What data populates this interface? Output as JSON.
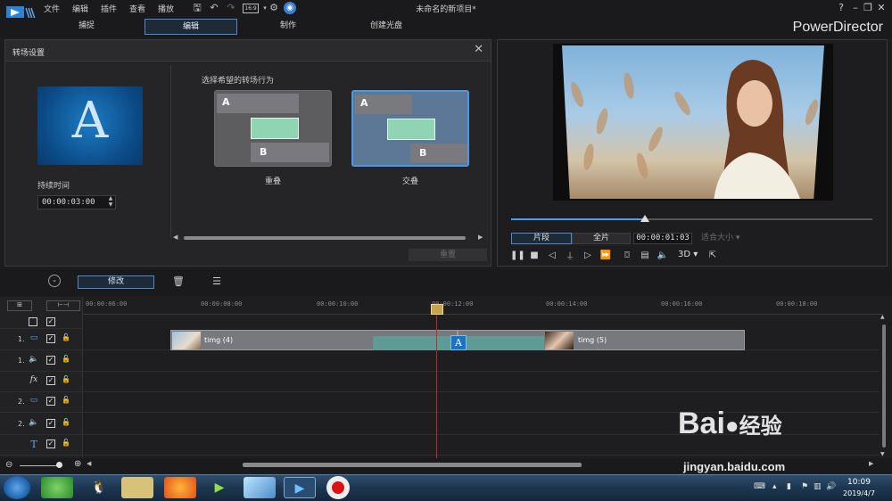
{
  "menu": [
    "文件",
    "编辑",
    "插件",
    "查看",
    "播放"
  ],
  "title_bar": {
    "doc_title": "未命名的新项目*",
    "aspect": "16:9",
    "help": "?"
  },
  "mode_tabs": [
    {
      "label": "捕捉",
      "active": false
    },
    {
      "label": "编辑",
      "active": true
    },
    {
      "label": "制作",
      "active": false
    },
    {
      "label": "创建光盘",
      "active": false
    }
  ],
  "brand": "PowerDirector",
  "transition_panel": {
    "title": "转场设置",
    "duration_label": "持续时间",
    "duration_value": "00:00:03:00",
    "behavior_label": "选择希望的转场行为",
    "options": [
      {
        "label": "重叠",
        "selected": false
      },
      {
        "label": "交叠",
        "selected": true
      }
    ],
    "thumb_letter": "A",
    "reset_label": "重置"
  },
  "preview": {
    "segment_label": "片段",
    "full_label": "全片",
    "timecode": "00:00:01:03",
    "fit_label": "适合大小",
    "three_d": "3D",
    "progress": 0.37
  },
  "timeline_toolbar": {
    "modify_label": "修改"
  },
  "ruler": [
    "00:00:06:00",
    "00:00:08:00",
    "00:00:10:00",
    "00:00:12:00",
    "00:00:14:00",
    "00:00:16:00",
    "00:00:18:00"
  ],
  "tracks": [
    {
      "num": "1.",
      "icon": "video"
    },
    {
      "num": "1.",
      "icon": "audio"
    },
    {
      "num": "",
      "icon": "fx"
    },
    {
      "num": "2.",
      "icon": "video"
    },
    {
      "num": "2.",
      "icon": "audio"
    },
    {
      "num": "",
      "icon": "text"
    }
  ],
  "clips": [
    {
      "name": "timg (4)"
    },
    {
      "name": "timg (5)"
    }
  ],
  "transition_letter": "A",
  "taskbar": {
    "time": "10:09",
    "date": "2019/4/7"
  },
  "watermark": {
    "brand": "Bai",
    "brand2": "经验",
    "url": "jingyan.baidu.com"
  }
}
